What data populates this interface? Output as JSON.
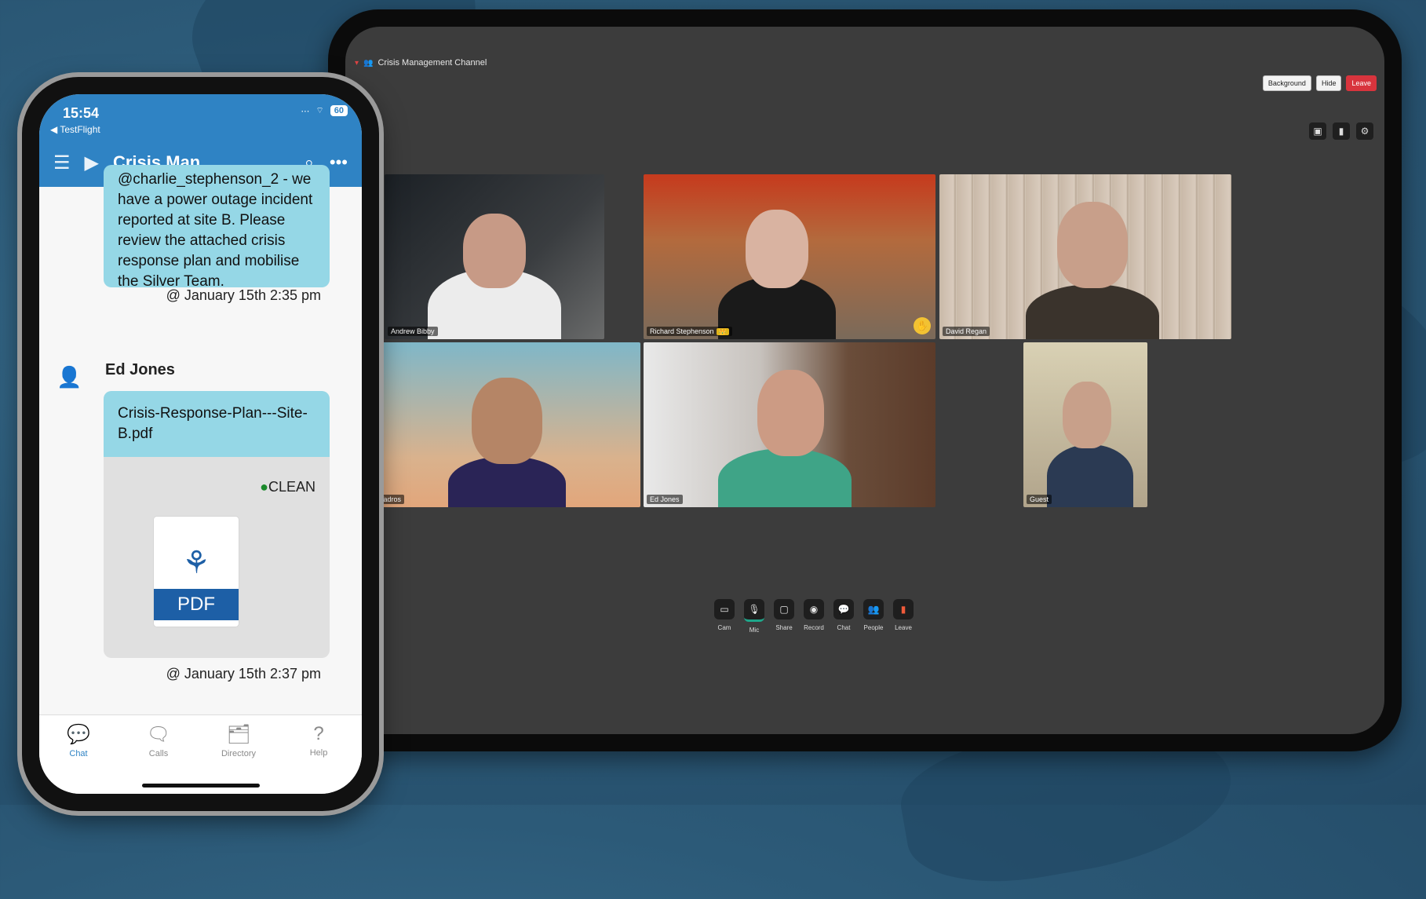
{
  "tablet": {
    "channel_title": "Crisis Management Channel",
    "top_buttons": [
      "Background",
      "Hide",
      "Leave"
    ],
    "participants": [
      "Andrew Bibby",
      "Richard Stephenson",
      "David Regan",
      "Tadros",
      "Ed Jones",
      "Guest"
    ],
    "host_badge": "✋",
    "toolbar": {
      "cam": "Cam",
      "mic": "Mic",
      "share": "Share",
      "record": "Record",
      "chat": "Chat",
      "people": "People",
      "leave": "Leave"
    }
  },
  "phone": {
    "time": "15:54",
    "back_label": "◀ TestFlight",
    "battery": "60",
    "title": "Crisis Man...",
    "message1": {
      "text": "@charlie_stephenson_2 - we have a power outage incident reported at site B. Please review the attached crisis response plan and mobilise the Silver Team.",
      "timestamp": "@ January 15th 2:35 pm"
    },
    "sender": "Ed Jones",
    "file": {
      "name": "Crisis-Response-Plan---Site-B.pdf",
      "scan_status": "CLEAN",
      "type_label": "PDF",
      "timestamp": "@ January 15th 2:37 pm"
    },
    "tabs": [
      "Chat",
      "Calls",
      "Directory",
      "Help"
    ]
  }
}
